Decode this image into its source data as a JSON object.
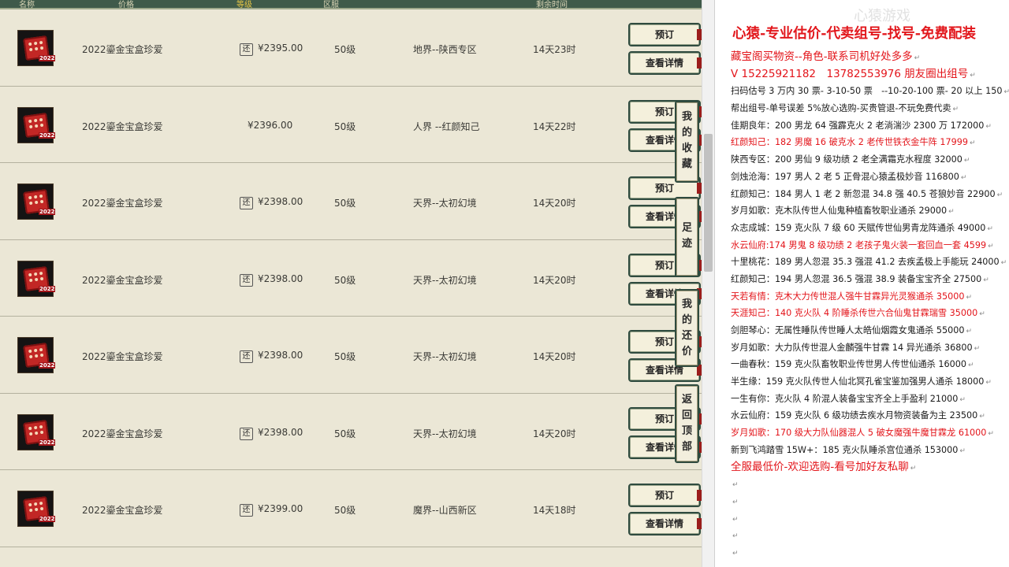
{
  "header": {
    "cols": [
      "名称",
      "价格",
      "等级",
      "区服",
      "剩余时间"
    ]
  },
  "listings": [
    {
      "icon_tag": "2022",
      "name": "2022鎏金宝盒珍爱",
      "bargain": "还",
      "price": "¥2395.00",
      "level": "50级",
      "server": "地界--陕西专区",
      "time_left": "14天23时"
    },
    {
      "icon_tag": "2022",
      "name": "2022鎏金宝盒珍爱",
      "bargain": "",
      "price": "¥2396.00",
      "level": "50级",
      "server": "人界 --红颜知己",
      "time_left": "14天22时"
    },
    {
      "icon_tag": "2022",
      "name": "2022鎏金宝盒珍爱",
      "bargain": "还",
      "price": "¥2398.00",
      "level": "50级",
      "server": "天界--太初幻境",
      "time_left": "14天20时"
    },
    {
      "icon_tag": "2022",
      "name": "2022鎏金宝盒珍爱",
      "bargain": "还",
      "price": "¥2398.00",
      "level": "50级",
      "server": "天界--太初幻境",
      "time_left": "14天20时"
    },
    {
      "icon_tag": "2022",
      "name": "2022鎏金宝盒珍爱",
      "bargain": "还",
      "price": "¥2398.00",
      "level": "50级",
      "server": "天界--太初幻境",
      "time_left": "14天20时"
    },
    {
      "icon_tag": "2022",
      "name": "2022鎏金宝盒珍爱",
      "bargain": "还",
      "price": "¥2398.00",
      "level": "50级",
      "server": "天界--太初幻境",
      "time_left": "14天20时"
    },
    {
      "icon_tag": "2022",
      "name": "2022鎏金宝盒珍爱",
      "bargain": "还",
      "price": "¥2399.00",
      "level": "50级",
      "server": "魔界--山西新区",
      "time_left": "14天18时"
    }
  ],
  "buttons": {
    "preorder": "预订",
    "detail": "查看详情"
  },
  "dock": {
    "favorites": "我的收藏",
    "trail": "足迹",
    "bargains": "我的还价",
    "back_to_top": "返回顶部"
  },
  "doc": {
    "title": "心猿-专业估价-代卖组号-找号-免费配装",
    "watermark": "心猿游戏",
    "lines": [
      {
        "text": "藏宝阁买物资--角色-联系司机好处多多",
        "red": true,
        "big": true
      },
      {
        "text": "V 15225921182　13782553976 朋友圈出组号",
        "red": true,
        "big": true
      },
      {
        "text": "扫码估号 3 万内 30 票- 3-10-50 票　--10-20-100 票- 20 以上 150",
        "red": false,
        "big": false
      },
      {
        "text": "帮出组号-单号误差 5%放心选购-买贵管退-不玩免费代卖",
        "red": false,
        "big": false
      },
      {
        "text": "佳期良年：200 男龙 64 强霹克火 2 老淌湍沙 2300 万 172000",
        "red": false,
        "big": false
      },
      {
        "text": "红颜知己：182 男魔 16 破克水 2 老传世铁衣金牛阵 17999",
        "red": true,
        "big": false
      },
      {
        "text": "陕西专区：200 男仙 9 级功绩 2 老全满霜克水程度 32000",
        "red": false,
        "big": false
      },
      {
        "text": "剑烛沧海：197 男人 2 老 5 正骨混心猿孟极妙音 116800",
        "red": false,
        "big": false
      },
      {
        "text": "红颜知己：184 男人 1 老 2 新忽混 34.8 强 40.5 苍狼妙音 22900",
        "red": false,
        "big": false
      },
      {
        "text": "岁月如歌：克木队传世人仙鬼种植畜牧职业通杀 29000",
        "red": false,
        "big": false
      },
      {
        "text": "众志成城：159 克火队 7 级 60 天赋传世仙男青龙阵通杀 49000",
        "red": false,
        "big": false
      },
      {
        "text": "水云仙府:174 男鬼 8 级功绩 2 老孩子鬼火装一套回血一套 4599",
        "red": true,
        "big": false
      },
      {
        "text": "十里桃花：189 男人忽混 35.3 强混 41.2 去疾孟极上手能玩 24000",
        "red": false,
        "big": false
      },
      {
        "text": "红颜知己：194 男人忽混 36.5 强混 38.9 装备宝宝齐全 27500",
        "red": false,
        "big": false
      },
      {
        "text": "天若有情：克木大力传世混人强牛甘霖异光灵猴通杀 35000",
        "red": true,
        "big": false
      },
      {
        "text": "天涯知己：140 克火队 4 阶睡杀传世六合仙鬼甘霖瑞雪 35000",
        "red": true,
        "big": false
      },
      {
        "text": "剑胆琴心：无属性睡队传世睡人太皓仙烟霞女鬼通杀 55000",
        "red": false,
        "big": false
      },
      {
        "text": "岁月如歌：大力队传世混人金麟强牛甘霖 14 异光通杀 36800",
        "red": false,
        "big": false
      },
      {
        "text": "一曲春秋：159 克火队畜牧职业传世男人传世仙通杀 16000",
        "red": false,
        "big": false
      },
      {
        "text": "半生缘：159 克火队传世人仙北冥孔雀宝鉴加强男人通杀 18000",
        "red": false,
        "big": false
      },
      {
        "text": "一生有你：克火队 4 阶混人装备宝宝齐全上手盈利 21000",
        "red": false,
        "big": false
      },
      {
        "text": "水云仙府：159 克火队 6 级功绩去疾水月物资装备为主 23500",
        "red": false,
        "big": false
      },
      {
        "text": "岁月如歌：170 级大力队仙器混人 5 破女魔强牛魔甘霖龙 61000",
        "red": true,
        "big": false
      },
      {
        "text": "新到飞鸿踏雪 15W+：185 克火队睡杀宫位通杀 153000",
        "red": false,
        "big": false
      },
      {
        "text": "全服最低价-欢迎选购-看号加好友私聊",
        "red": true,
        "big": true
      },
      {
        "text": "",
        "red": false,
        "big": false
      },
      {
        "text": "",
        "red": false,
        "big": false
      },
      {
        "text": "",
        "red": false,
        "big": false
      },
      {
        "text": "",
        "red": false,
        "big": false
      },
      {
        "text": "",
        "red": false,
        "big": false
      },
      {
        "text": "",
        "red": false,
        "big": false
      }
    ]
  }
}
